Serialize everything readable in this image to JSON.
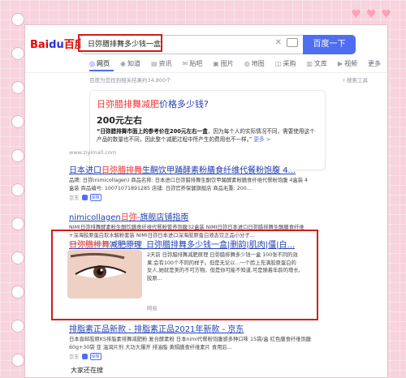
{
  "deco": {
    "hearts": [
      "♥",
      "♥",
      "♥"
    ]
  },
  "search": {
    "logo_main": "Bai",
    "logo_paw": "du",
    "logo_cn": "百度",
    "query": "日弥腊排舞多少钱一盒",
    "button": "百度一下"
  },
  "tabs": [
    {
      "label": "网页",
      "icon": "search-icon"
    },
    {
      "label": "知道",
      "icon": "question-icon"
    },
    {
      "label": "资讯",
      "icon": "news-icon"
    },
    {
      "label": "贴吧",
      "icon": "forum-icon"
    },
    {
      "label": "图片",
      "icon": "image-icon"
    },
    {
      "label": "地图",
      "icon": "map-icon"
    },
    {
      "label": "采购",
      "icon": "cart-icon"
    },
    {
      "label": "文库",
      "icon": "doc-icon"
    },
    {
      "label": "视频",
      "icon": "video-icon"
    },
    {
      "label": "更多",
      "icon": ""
    }
  ],
  "found_text": "百度为您找到相关结果约34,800个",
  "search_tool": "搜索工具",
  "answer": {
    "question_kw": "日弥腊排舞减肥",
    "question_rest": "价格多少钱?",
    "big": "200元左右",
    "text_bold": "“日弥腊排舞市面上的参考价在200元左右一盒",
    "text_rest": "，因为每个人的实际情况不同，需要使用这个产品的数量也不同，因此整个减肥过程中所产生的费用也不一样。”",
    "more": "更多 >",
    "source": "www.ziyimall.com"
  },
  "results": [
    {
      "title_a": "日本进口",
      "title_kw": "日弥腊排舞",
      "title_b": "生酮饮甲踊酵素粉膳食纤维代餐粉饱腹 4...",
      "desc": "品牌: 日弥(nimicollagen) 商品名称: 日本进口日弥腊排舞生酮饮甲踊酵素粉膳食纤维代餐粉饱腹 4盒装 4盒装 商品编号: 10071071891285 店铺: 日弥官养保健旗舰店 商品毛重: 200...",
      "site": "京东",
      "badge": "保障"
    },
    {
      "title_a": "nimicollagen",
      "title_kw": "日弥",
      "title_b": "-旗舰店铺指南",
      "desc": "NIMI日弥排舞酵素粉生酮饮膳食纤维代餐粉管养饱腹32盒装 NIMI日弥日本进口日弥腊排舞生酮膳食纤维+深海胶原蛋白软水解粉套装 NIMI日弥日本进口深海胶原蛋白液态饮正品小分子...",
      "site": "nimicollagen.shop.kuaidiwo",
      "badge": ""
    },
    {
      "title_a": "",
      "title_kw": "日弥腊排舞",
      "title_b": "减肥原理_日弥腊排舞多少钱一盒|删韵|肌肉|僵|白...",
      "desc": "2天前 日弥腊排舞减肥原理 日弥腊排舞多少钱一盒 100张不同的效果,会有100个不同的样子。但是无论以...一个脸上充满胶原蛋白的女人,她就是美的不可方物。但是你可能不知道,可是随着年龄的增长,胶原...",
      "site": "网易",
      "badge": ""
    },
    {
      "title_a": "",
      "title_kw": "",
      "title_b": "排脂素正品新款 - 排脂素正品2021年新款 - 京东",
      "desc": "日本直邮胶原KS排脂素排舞减肥粉 复合酵素粉 日本nimi代餐粉饱腹感多种口味 15袋/盒 红色膳食纤维饱腹 60g+30袋 亚 温润片剂 大功大爆开 排油脂 黄隔膳食纤维素片 食用后...",
      "site": "京东",
      "badge": "保障"
    }
  ],
  "also_search": "大家还在搜"
}
